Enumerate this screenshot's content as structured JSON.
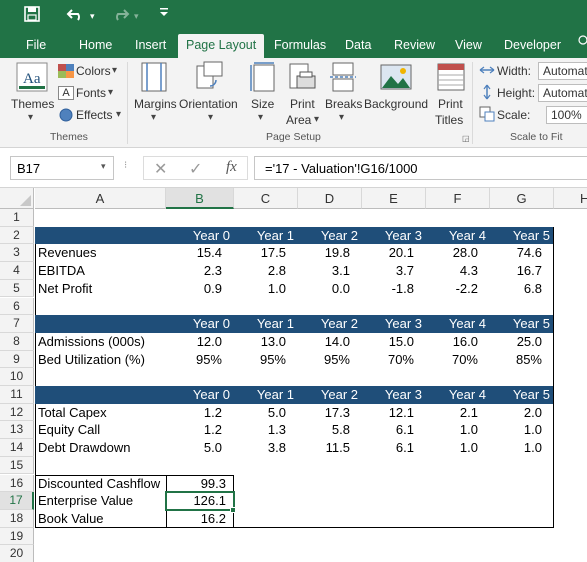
{
  "titlebar": {
    "qat_save": "save",
    "qat_undo": "undo",
    "qat_redo": "redo",
    "qat_more": "more"
  },
  "tabs": [
    {
      "label": "File"
    },
    {
      "label": "Home"
    },
    {
      "label": "Insert"
    },
    {
      "label": "Page Layout",
      "active": true
    },
    {
      "label": "Formulas"
    },
    {
      "label": "Data"
    },
    {
      "label": "Review"
    },
    {
      "label": "View"
    },
    {
      "label": "Developer"
    }
  ],
  "ribbon": {
    "themes": {
      "themes_label": "Themes",
      "colors_label": "Colors",
      "fonts_label": "Fonts",
      "effects_label": "Effects",
      "group_label": "Themes"
    },
    "page_setup": {
      "margins": "Margins",
      "orientation": "Orientation",
      "size": "Size",
      "print_area_1": "Print",
      "print_area_2": "Area",
      "breaks": "Breaks",
      "background": "Background",
      "print_titles_1": "Print",
      "print_titles_2": "Titles",
      "group_label": "Page Setup"
    },
    "scale_to_fit": {
      "width_label": "Width:",
      "width_value": "Automatic",
      "height_label": "Height:",
      "height_value": "Automatic",
      "scale_label": "Scale:",
      "scale_value": "100%",
      "group_label": "Scale to Fit"
    }
  },
  "formula_bar": {
    "name_box": "B17",
    "formula": "='17 - Valuation'!G16/1000",
    "cancel": "✕",
    "enter": "✓",
    "fx": "fx"
  },
  "columns": [
    "A",
    "B",
    "C",
    "D",
    "E",
    "F",
    "G",
    "H"
  ],
  "rows": [
    "1",
    "2",
    "3",
    "4",
    "5",
    "6",
    "7",
    "8",
    "9",
    "10",
    "11",
    "12",
    "13",
    "14",
    "15",
    "16",
    "17",
    "18",
    "19",
    "20"
  ],
  "selected": {
    "column": "B",
    "row": "17"
  },
  "sheet": {
    "header_years": [
      "Year 0",
      "Year 1",
      "Year 2",
      "Year 3",
      "Year 4",
      "Year 5"
    ],
    "table1": [
      {
        "label": "Revenues",
        "values": [
          "15.4",
          "17.5",
          "19.8",
          "20.1",
          "28.0",
          "74.6"
        ]
      },
      {
        "label": "EBITDA",
        "values": [
          "2.3",
          "2.8",
          "3.1",
          "3.7",
          "4.3",
          "16.7"
        ]
      },
      {
        "label": "Net Profit",
        "values": [
          "0.9",
          "1.0",
          "0.0",
          "-1.8",
          "-2.2",
          "6.8"
        ]
      }
    ],
    "table2": [
      {
        "label": "Admissions (000s)",
        "values": [
          "12.0",
          "13.0",
          "14.0",
          "15.0",
          "16.0",
          "25.0"
        ]
      },
      {
        "label": "Bed Utilization (%)",
        "values": [
          "95%",
          "95%",
          "95%",
          "70%",
          "70%",
          "85%"
        ]
      }
    ],
    "table3": [
      {
        "label": "Total Capex",
        "values": [
          "1.2",
          "5.0",
          "17.3",
          "12.1",
          "2.1",
          "2.0"
        ]
      },
      {
        "label": "Equity Call",
        "values": [
          "1.2",
          "1.3",
          "5.8",
          "6.1",
          "1.0",
          "1.0"
        ]
      },
      {
        "label": "Debt Drawdown",
        "values": [
          "5.0",
          "3.8",
          "11.5",
          "6.1",
          "1.0",
          "1.0"
        ]
      }
    ],
    "valuation": [
      {
        "label": "Discounted Cashflow",
        "value": "99.3"
      },
      {
        "label": "Enterprise Value",
        "value": "126.1"
      },
      {
        "label": "Book Value",
        "value": "16.2"
      }
    ]
  },
  "colors": {
    "excel_green": "#217346",
    "band_blue": "#1f4e79"
  }
}
